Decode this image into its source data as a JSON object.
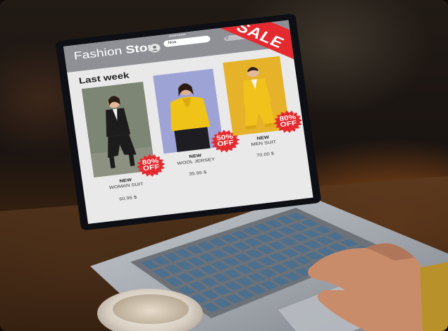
{
  "store": {
    "title_light": "Fashion",
    "title_bold": "Store",
    "username_label": "Username",
    "username_value": "Noa",
    "sale_label": "SALE",
    "section_heading": "Last week"
  },
  "products": [
    {
      "tag": "NEW",
      "name": "WOMAN SUIT",
      "price": "60.95 $",
      "discount": "80%",
      "off": "OFF",
      "photo_bg": "#7d8574",
      "outfit": "#1c1c1c",
      "skin": "#e2b79a"
    },
    {
      "tag": "NEW",
      "name": "WOOL JERSEY",
      "price": "35.95 $",
      "discount": "50%",
      "off": "OFF",
      "photo_bg": "#9ea3d6",
      "outfit": "#f0c318",
      "skin": "#e0b092"
    },
    {
      "tag": "NEW",
      "name": "MEN SUIT",
      "price": "70.00 $",
      "discount": "80%",
      "off": "OFF",
      "photo_bg": "#e6b22a",
      "outfit": "#f2c21c",
      "skin": "#e4b99c"
    }
  ],
  "icons": {
    "avatar": "user-avatar-icon",
    "search": "search-icon"
  },
  "colors": {
    "sale_red": "#e52a2f",
    "topbar": "#8f9096",
    "laptop_silver": "#a9adb4",
    "key_blue": "#4c6f8e"
  }
}
